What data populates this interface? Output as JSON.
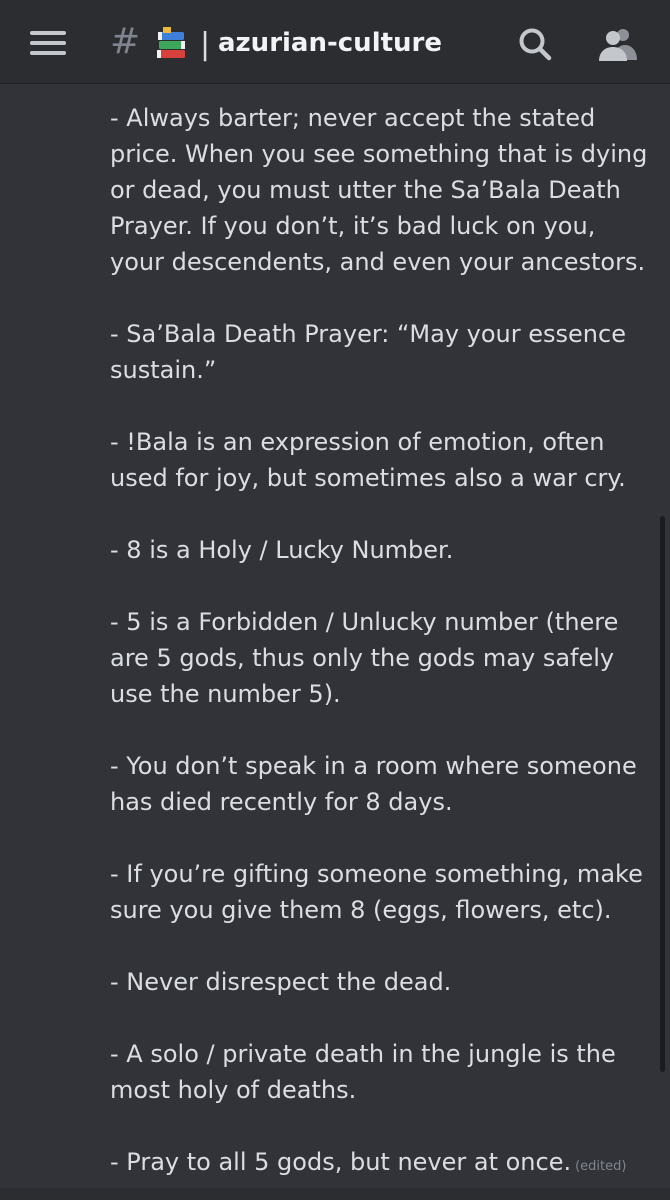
{
  "header": {
    "hash_symbol": "#",
    "channel_emoji": "books-emoji",
    "separator": "|",
    "channel_name": "azurian-culture",
    "icons": {
      "menu": "hamburger-menu-icon",
      "search": "search-icon",
      "members": "members-icon"
    }
  },
  "message": {
    "paragraphs": [
      "- Always barter; never accept the stated price. When you see something that is dying or dead, you must utter the Sa’Bala Death Prayer. If you don’t, it’s bad luck on you, your descendents, and even your ancestors.",
      "- Sa’Bala Death Prayer: “May your essence sustain.”",
      "- !Bala is an expression of emotion, often used for joy, but sometimes also a war cry.",
      "- 8 is a Holy / Lucky Number.",
      "- 5 is a Forbidden / Unlucky number (there are 5 gods, thus only the gods may safely use the number 5).",
      "- You don’t speak in a room where someone has died recently for 8 days.",
      "- If you’re gifting someone something, make sure you give them 8 (eggs, flowers, etc).",
      "- Never disrespect the dead.",
      "- A solo / private death in the jungle is the most holy of deaths.",
      "- Pray to all 5 gods, but never at once."
    ],
    "edited_label": "(edited)"
  },
  "colors": {
    "background": "#313338",
    "header_background": "#2b2d31",
    "text": "#dbdee1",
    "muted": "#80848e"
  }
}
